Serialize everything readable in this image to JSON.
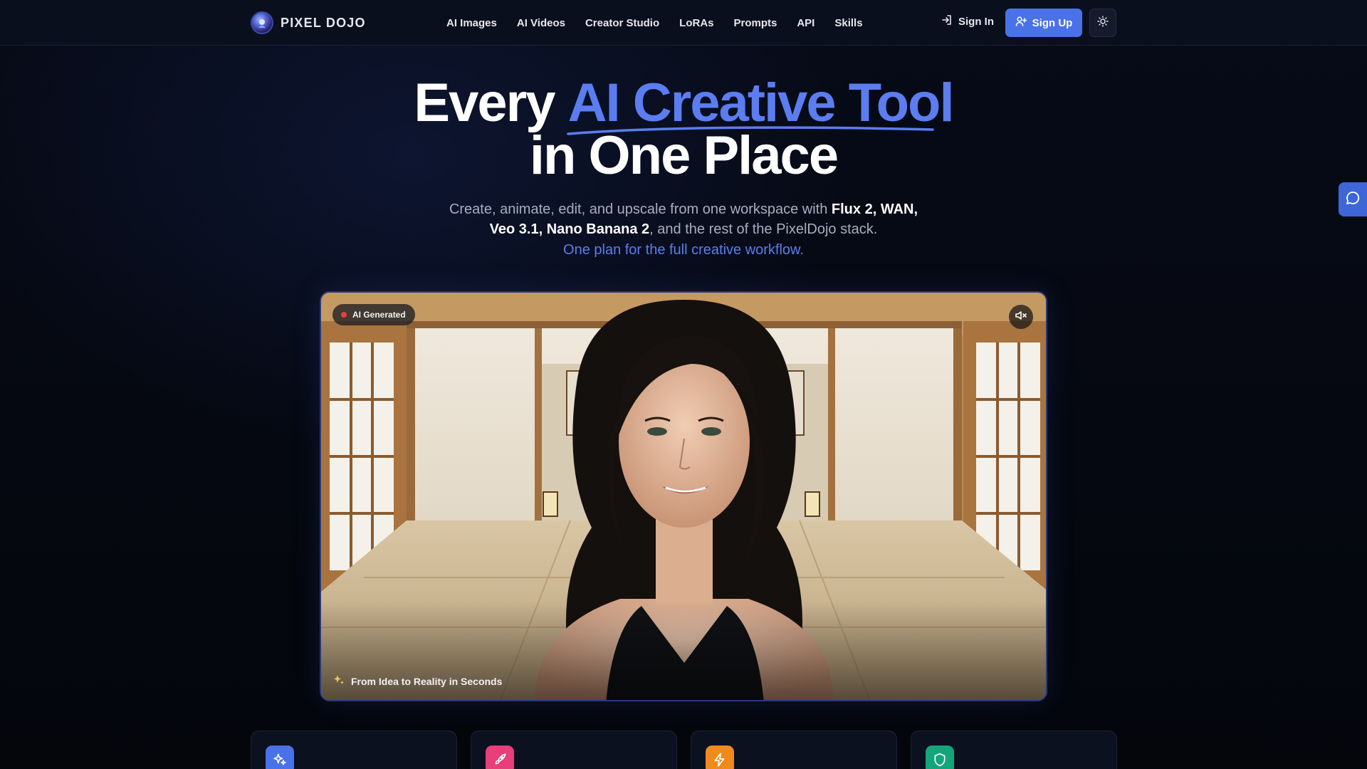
{
  "brand": {
    "name": "PIXEL DOJO"
  },
  "nav": {
    "links": [
      "AI Images",
      "AI Videos",
      "Creator Studio",
      "LoRAs",
      "Prompts",
      "API",
      "Skills"
    ],
    "sign_in": "Sign In",
    "sign_up": "Sign Up"
  },
  "hero": {
    "title_prefix": "Every",
    "title_accent": "AI Creative Tool",
    "title_line2": "in One Place",
    "subtitle_part1": "Create, animate, edit, and upscale from one workspace with ",
    "subtitle_bold1": "Flux 2, WAN,",
    "subtitle_bold2": "Veo 3.1, Nano Banana 2",
    "subtitle_part2": ", and the rest of the PixelDojo stack.",
    "tagline": "One plan for the full creative workflow."
  },
  "video": {
    "badge": "AI Generated",
    "caption": "From Idea to Reality in Seconds",
    "muted": true
  },
  "feature_cards": [
    {
      "icon": "sparkles-icon",
      "color": "#4a72e8"
    },
    {
      "icon": "rocket-icon",
      "color": "#e83e7a"
    },
    {
      "icon": "lightning-icon",
      "color": "#f08a1c"
    },
    {
      "icon": "shield-icon",
      "color": "#14a57a"
    }
  ],
  "colors": {
    "accent": "#5b7df0",
    "primary_button": "#4a72e8",
    "badge_dot": "#e84040"
  }
}
